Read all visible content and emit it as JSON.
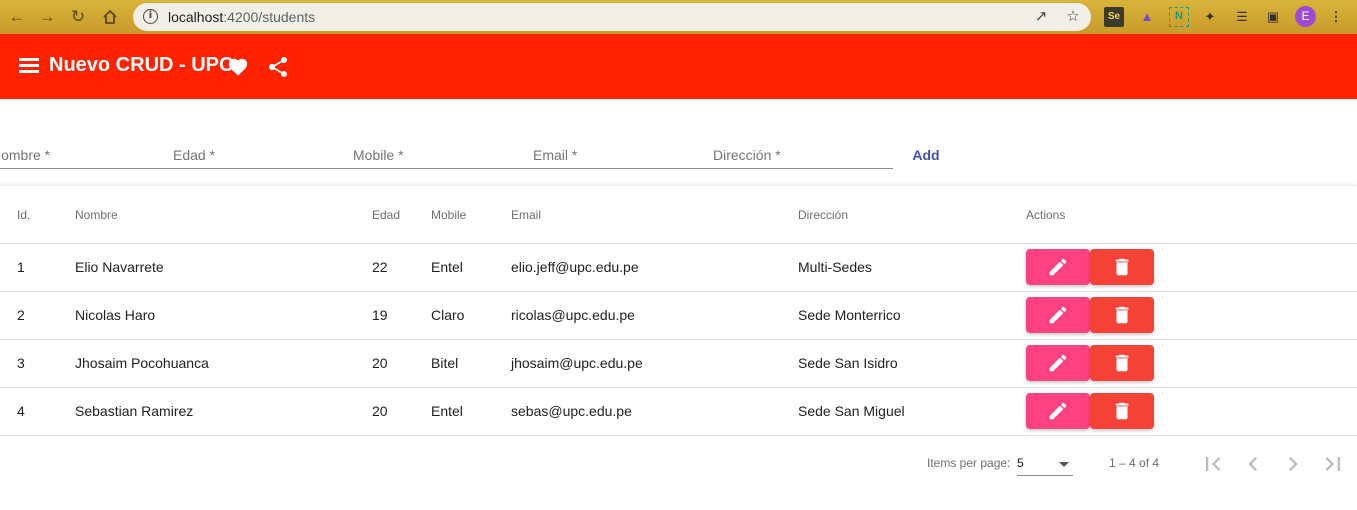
{
  "browser": {
    "url_host": "localhost",
    "url_path": ":4200/students"
  },
  "toolbar": {
    "title": "Nuevo CRUD - UPC",
    "bg_color": "#ff2200"
  },
  "form": {
    "fields": [
      {
        "label": "Nombre *"
      },
      {
        "label": "Edad *"
      },
      {
        "label": "Mobile *"
      },
      {
        "label": "Email *"
      },
      {
        "label": "Dirección *"
      }
    ],
    "add_label": "Add"
  },
  "table": {
    "headers": [
      "Id.",
      "Nombre",
      "Edad",
      "Mobile",
      "Email",
      "Dirección",
      "Actions"
    ],
    "rows": [
      {
        "id": "1",
        "nombre": "Elio Navarrete",
        "edad": "22",
        "mobile": "Entel",
        "email": "elio.jeff@upc.edu.pe",
        "direccion": "Multi-Sedes"
      },
      {
        "id": "2",
        "nombre": "Nicolas Haro",
        "edad": "19",
        "mobile": "Claro",
        "email": "ricolas@upc.edu.pe",
        "direccion": "Sede Monterrico"
      },
      {
        "id": "3",
        "nombre": "Jhosaim Pocohuanca",
        "edad": "20",
        "mobile": "Bitel",
        "email": "jhosaim@upc.edu.pe",
        "direccion": "Sede San Isidro"
      },
      {
        "id": "4",
        "nombre": "Sebastian Ramirez",
        "edad": "20",
        "mobile": "Entel",
        "email": "sebas@upc.edu.pe",
        "direccion": "Sede San Miguel"
      }
    ],
    "edit_color": "#ff4081",
    "delete_color": "#f44336"
  },
  "paginator": {
    "items_per_page_label": "Items per page:",
    "page_size": "5",
    "range_label": "1 – 4 of 4"
  }
}
